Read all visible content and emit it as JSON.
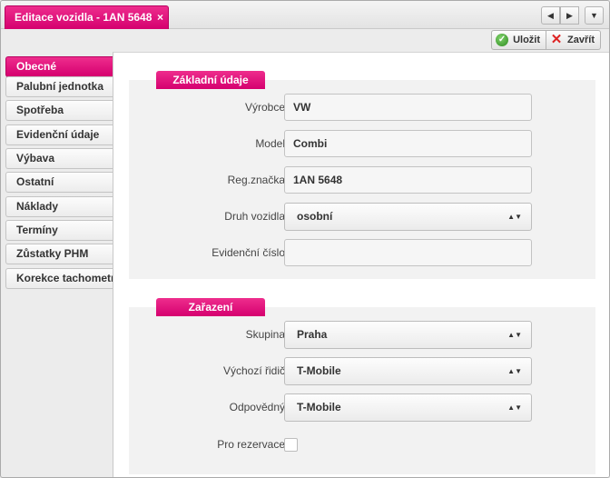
{
  "tab": {
    "title": "Editace vozidla - 1AN 5648",
    "close_glyph": "×"
  },
  "nav": {
    "prev_glyph": "◀",
    "next_glyph": "▶",
    "menu_glyph": "▼"
  },
  "toolbar": {
    "save_label": "Uložit",
    "close_label": "Zavřít",
    "save_icon": "check-circle-icon",
    "close_icon": "red-x-icon"
  },
  "sidebar": {
    "items": [
      {
        "label": "Obecné",
        "active": true
      },
      {
        "label": "Palubní jednotka"
      },
      {
        "label": "Spotřeba"
      },
      {
        "label": "Evidenční údaje"
      },
      {
        "label": "Výbava"
      },
      {
        "label": "Ostatní"
      },
      {
        "label": "Náklady"
      },
      {
        "label": "Termíny"
      },
      {
        "label": "Zůstatky PHM"
      },
      {
        "label": "Korekce tachometru"
      }
    ]
  },
  "basic": {
    "title": "Základní údaje",
    "fields": [
      {
        "label": "Výrobce",
        "value": "VW"
      },
      {
        "label": "Model",
        "value": "Combi"
      },
      {
        "label": "Reg.značka",
        "value": "1AN 5648"
      },
      {
        "label": "Druh vozidla",
        "value": "osobní"
      },
      {
        "label": "Evidenční číslo",
        "value": ""
      }
    ]
  },
  "assign": {
    "title": "Zařazení",
    "fields": [
      {
        "label": "Skupina",
        "value": "Praha"
      },
      {
        "label": "Výchozí řidič",
        "value": "T-Mobile"
      },
      {
        "label": "Odpovědný",
        "value": "T-Mobile"
      },
      {
        "label": "Pro rezervace",
        "checked": false
      }
    ]
  },
  "colors": {
    "accent": "#e2127a"
  }
}
